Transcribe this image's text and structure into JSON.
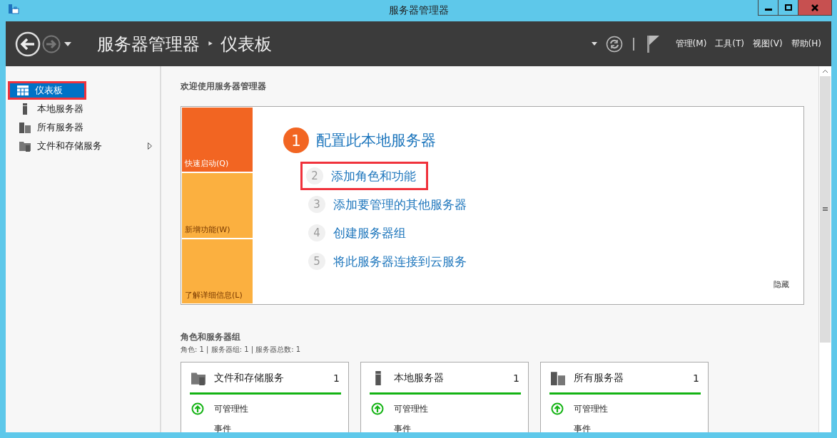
{
  "window": {
    "title": "服务器管理器"
  },
  "header": {
    "breadcrumb_root": "服务器管理器",
    "breadcrumb_separator": "‣",
    "breadcrumb_current": "仪表板",
    "menus": [
      "管理(M)",
      "工具(T)",
      "视图(V)",
      "帮助(H)"
    ]
  },
  "sidebar": {
    "items": [
      {
        "label": "仪表板",
        "kind": "grid",
        "selected": true,
        "highlighted": true,
        "expandable": false
      },
      {
        "label": "本地服务器",
        "kind": "server",
        "selected": false,
        "highlighted": false,
        "expandable": false
      },
      {
        "label": "所有服务器",
        "kind": "servers",
        "selected": false,
        "highlighted": false,
        "expandable": false
      },
      {
        "label": "文件和存储服务",
        "kind": "folder",
        "selected": false,
        "highlighted": false,
        "expandable": true
      }
    ]
  },
  "welcome": {
    "title": "欢迎使用服务器管理器",
    "tiles": [
      {
        "label": "快速启动(Q)",
        "color": "#f26522"
      },
      {
        "label": "新增功能(W)",
        "color": "#fbb040"
      },
      {
        "label": "了解详细信息(L)",
        "color": "#fbb040"
      }
    ],
    "steps": [
      {
        "kind": "primary",
        "number": "1",
        "label": "配置此本地服务器",
        "highlighted": false
      },
      {
        "kind": "step",
        "number": "2",
        "label": "添加角色和功能",
        "highlighted": true
      },
      {
        "kind": "step",
        "number": "3",
        "label": "添加要管理的其他服务器",
        "highlighted": false
      },
      {
        "kind": "step",
        "number": "4",
        "label": "创建服务器组",
        "highlighted": false
      },
      {
        "kind": "step",
        "number": "5",
        "label": "将此服务器连接到云服务",
        "highlighted": false
      }
    ],
    "hide": "隐藏"
  },
  "roles": {
    "title": "角色和服务器组",
    "summary": "角色: 1 | 服务器组: 1 | 服务器总数: 1",
    "cards": [
      {
        "title": "文件和存储服务",
        "kind": "folder",
        "count": "1",
        "rows": [
          {
            "kind": "status",
            "label": "可管理性"
          },
          {
            "kind": "plain",
            "label": "事件"
          }
        ]
      },
      {
        "title": "本地服务器",
        "kind": "server",
        "count": "1",
        "rows": [
          {
            "kind": "status",
            "label": "可管理性"
          },
          {
            "kind": "plain",
            "label": "事件"
          }
        ]
      },
      {
        "title": "所有服务器",
        "kind": "servers",
        "count": "1",
        "rows": [
          {
            "kind": "status",
            "label": "可管理性"
          },
          {
            "kind": "plain",
            "label": "事件"
          }
        ]
      }
    ]
  }
}
